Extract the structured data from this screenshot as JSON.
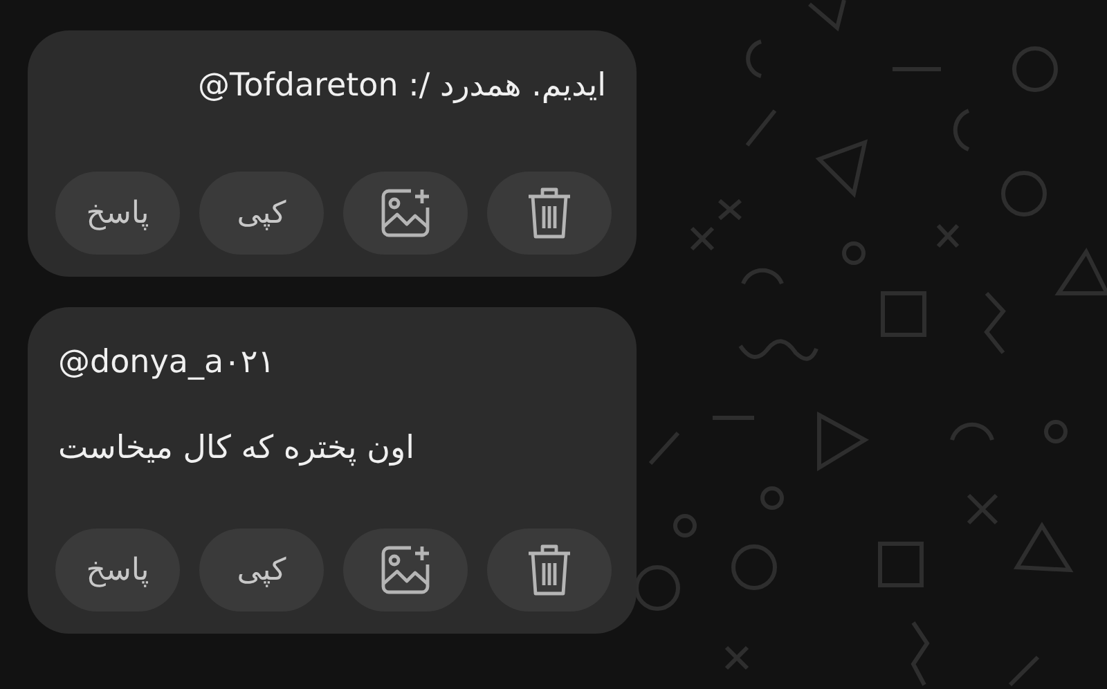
{
  "messages": [
    {
      "lines": [
        "ایدیم. همدرد /: Tofdareton@"
      ],
      "actions": [
        {
          "kind": "delete"
        },
        {
          "kind": "image"
        },
        {
          "kind": "copy",
          "label": "کپی"
        },
        {
          "kind": "reply",
          "label": "پاسخ"
        }
      ]
    },
    {
      "lines": [
        "@donya_a۰۲۱",
        "اون پختره که کال میخاست"
      ],
      "actions": [
        {
          "kind": "delete"
        },
        {
          "kind": "image"
        },
        {
          "kind": "copy",
          "label": "کپی"
        },
        {
          "kind": "reply",
          "label": "پاسخ"
        }
      ]
    }
  ]
}
